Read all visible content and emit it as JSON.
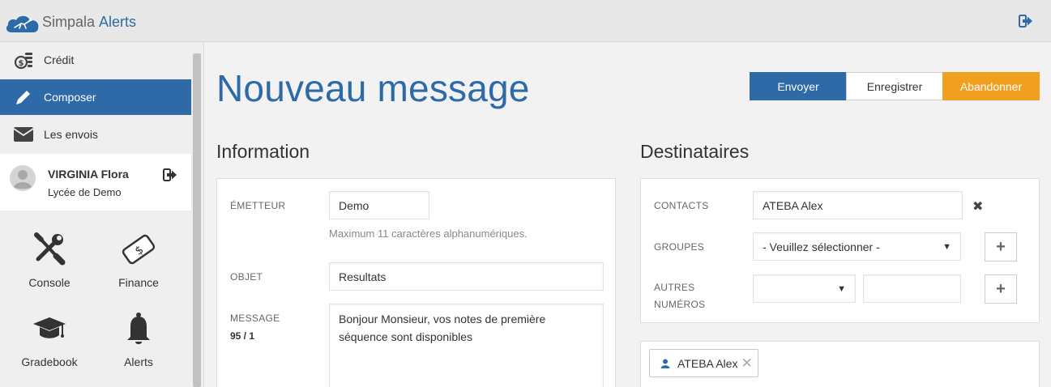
{
  "header": {
    "brand": "Simpala",
    "brand_accent": "Alerts",
    "logo_icon": "deer-cloud-logo",
    "logout_icon": "sign-out-icon"
  },
  "sidebar": {
    "items": [
      {
        "label": "Crédit",
        "icon": "coins-icon",
        "active": false
      },
      {
        "label": "Composer",
        "icon": "pencil-icon",
        "active": true
      },
      {
        "label": "Les envois",
        "icon": "envelope-icon",
        "active": false
      }
    ],
    "user": {
      "name": "VIRGINIA Flora",
      "school": "Lycée de Demo"
    },
    "apps": [
      {
        "label": "Console",
        "icon": "wrench-screwdriver-icon"
      },
      {
        "label": "Finance",
        "icon": "money-icon"
      },
      {
        "label": "Gradebook",
        "icon": "graduation-cap-icon"
      },
      {
        "label": "Alerts",
        "icon": "bell-icon"
      }
    ]
  },
  "page": {
    "title": "Nouveau message",
    "actions": {
      "send": "Envoyer",
      "save": "Enregistrer",
      "abort": "Abandonner"
    }
  },
  "information": {
    "title": "Information",
    "sender_label": "ÉMETTEUR",
    "sender_value": "Demo",
    "sender_hint": "Maximum 11 caractères alphanumériques.",
    "subject_label": "OBJET",
    "subject_value": "Resultats",
    "message_label": "MESSAGE",
    "message_counter": "95 / 1",
    "message_value": "Bonjour Monsieur, vos notes de première séquence sont disponibles"
  },
  "recipients": {
    "title": "Destinataires",
    "contacts_label": "CONTACTS",
    "contacts_value": "ATEBA Alex",
    "groups_label": "GROUPES",
    "groups_value": "- Veuillez sélectionner -",
    "other_label_1": "AUTRES",
    "other_label_2": "NUMÉROS",
    "other_select_value": "",
    "other_number_value": "",
    "add_symbol": "+",
    "clear_symbol": "✖",
    "chip_name": "ATEBA Alex",
    "chip_close": "✕"
  },
  "colors": {
    "primary": "#2e6aa8",
    "warning": "#f0a01e",
    "sidebar_active": "#2e6aa8"
  }
}
